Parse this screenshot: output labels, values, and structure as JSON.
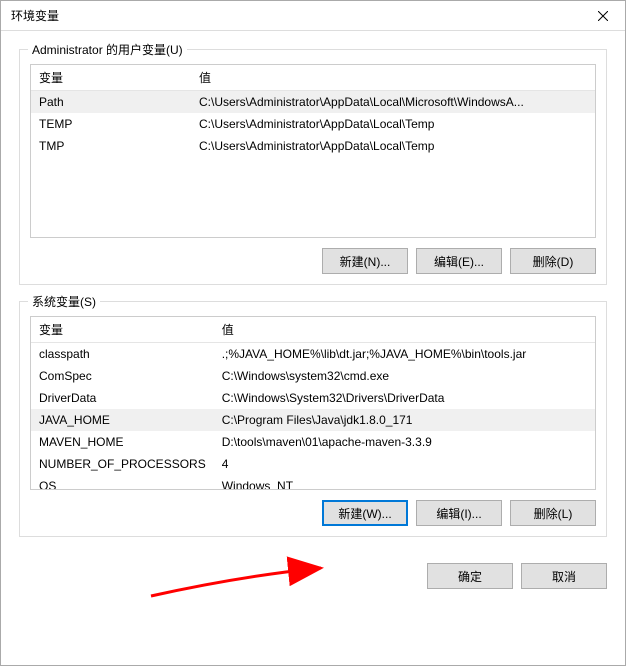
{
  "title": "环境变量",
  "userVars": {
    "legend": "Administrator 的用户变量(U)",
    "headers": {
      "var": "变量",
      "val": "值"
    },
    "rows": [
      {
        "var": "Path",
        "val": "C:\\Users\\Administrator\\AppData\\Local\\Microsoft\\WindowsA...",
        "selected": true
      },
      {
        "var": "TEMP",
        "val": "C:\\Users\\Administrator\\AppData\\Local\\Temp"
      },
      {
        "var": "TMP",
        "val": "C:\\Users\\Administrator\\AppData\\Local\\Temp"
      }
    ],
    "buttons": {
      "new": "新建(N)...",
      "edit": "编辑(E)...",
      "del": "删除(D)"
    }
  },
  "sysVars": {
    "legend": "系统变量(S)",
    "headers": {
      "var": "变量",
      "val": "值"
    },
    "rows": [
      {
        "var": "classpath",
        "val": ".;%JAVA_HOME%\\lib\\dt.jar;%JAVA_HOME%\\bin\\tools.jar"
      },
      {
        "var": "ComSpec",
        "val": "C:\\Windows\\system32\\cmd.exe"
      },
      {
        "var": "DriverData",
        "val": "C:\\Windows\\System32\\Drivers\\DriverData"
      },
      {
        "var": "JAVA_HOME",
        "val": "C:\\Program Files\\Java\\jdk1.8.0_171",
        "selected": true
      },
      {
        "var": "MAVEN_HOME",
        "val": "D:\\tools\\maven\\01\\apache-maven-3.3.9"
      },
      {
        "var": "NUMBER_OF_PROCESSORS",
        "val": "4"
      },
      {
        "var": "OS",
        "val": "Windows_NT"
      }
    ],
    "buttons": {
      "new": "新建(W)...",
      "edit": "编辑(I)...",
      "del": "删除(L)"
    }
  },
  "dialogButtons": {
    "ok": "确定",
    "cancel": "取消"
  }
}
